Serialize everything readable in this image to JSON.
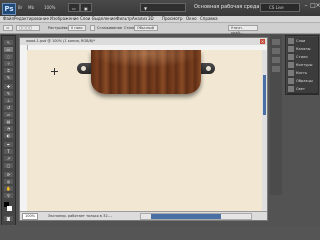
{
  "app": {
    "logo": "Ps",
    "zoom": "100%",
    "workspace": "Основная рабочая среда",
    "search_placeholder": "CS Live"
  },
  "menu": [
    "Файл",
    "Редактирование",
    "Изображение",
    "Слои",
    "Выделение",
    "Фильтр",
    "Анализ",
    "3D",
    "Просмотр",
    "Окно",
    "Справка"
  ],
  "options_bar": {
    "feather_label": "Растушёвка:",
    "feather_value": "0 пикс",
    "antialias_label": "Сглаживание",
    "style_label": "Стиль:",
    "style_value": "Обычный",
    "refine_button": "Уточн. край..."
  },
  "document": {
    "title": "wood-1.psd @ 100% (1 копия, RGB/8)*",
    "zoom_value": "100%",
    "status_text": "Экспонир. работает только в 32-..."
  },
  "panels": [
    "Слои",
    "Каналы",
    "Стили",
    "Контуры",
    "Кисть",
    "Образцы",
    "Свет"
  ],
  "colors": {
    "canvas_bg": "#f1e7d3",
    "plank": "#6b3a1d",
    "scroll_accent": "#4a6fa5"
  }
}
